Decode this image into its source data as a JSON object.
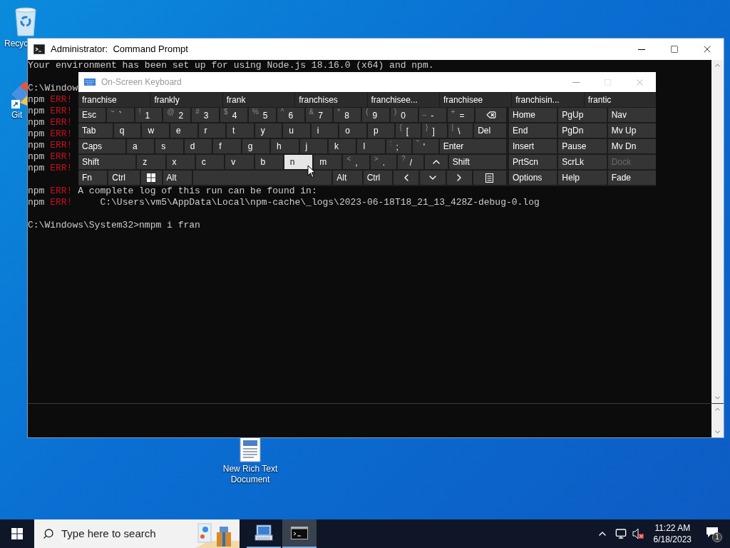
{
  "desktop_icons": [
    {
      "kind": "recycle",
      "label": "Recyc"
    },
    {
      "kind": "git",
      "label": "Git"
    },
    {
      "kind": "document",
      "label": "New Rich Text Document"
    }
  ],
  "console": {
    "title": "Administrator:  Command Prompt",
    "lines": [
      {
        "kind": "text",
        "text": "Your environment has been set up for using Node.js 18.16.0 (x64) and npm."
      },
      {
        "kind": "blank"
      },
      {
        "kind": "text",
        "text": "C:\\Window"
      },
      {
        "kind": "error",
        "prefix": "npm",
        "tag": "ERR!"
      },
      {
        "kind": "error",
        "prefix": "npm",
        "tag": "ERR!"
      },
      {
        "kind": "error",
        "prefix": "npm",
        "tag": "ERR!"
      },
      {
        "kind": "error",
        "prefix": "npm",
        "tag": "ERR!"
      },
      {
        "kind": "error",
        "prefix": "npm",
        "tag": "ERR!"
      },
      {
        "kind": "error",
        "prefix": "npm",
        "tag": "ERR!"
      },
      {
        "kind": "error",
        "prefix": "npm",
        "tag": "ERR!"
      },
      {
        "kind": "blank"
      },
      {
        "kind": "error",
        "prefix": "npm",
        "tag": "ERR!",
        "text": "A complete log of this run can be found in:"
      },
      {
        "kind": "error",
        "prefix": "npm",
        "tag": "ERR!",
        "text": "    C:\\Users\\vm5\\AppData\\Local\\npm-cache\\_logs\\2023-06-18T18_21_13_428Z-debug-0.log"
      },
      {
        "kind": "blank"
      },
      {
        "kind": "text",
        "text": "C:\\Windows\\System32>nmpm i fran"
      }
    ]
  },
  "keyboard": {
    "title": "On-Screen Keyboard",
    "suggestions": [
      "franchise",
      "frankly",
      "frank",
      "franchises",
      "franchisee...",
      "franchisee",
      "franchisin...",
      "frantic"
    ],
    "rows": [
      {
        "keys": [
          {
            "kind": "label",
            "main": "Esc",
            "highlighted": false
          },
          {
            "kind": "char",
            "top": "~",
            "main": "`",
            "highlighted": false
          },
          {
            "kind": "char",
            "top": "!",
            "main": "1",
            "highlighted": false
          },
          {
            "kind": "char",
            "top": "@",
            "main": "2",
            "highlighted": false
          },
          {
            "kind": "char",
            "top": "#",
            "main": "3",
            "highlighted": false
          },
          {
            "kind": "char",
            "top": "$",
            "main": "4",
            "highlighted": false
          },
          {
            "kind": "char",
            "top": "%",
            "main": "5",
            "highlighted": false
          },
          {
            "kind": "char",
            "top": "^",
            "main": "6",
            "highlighted": false
          },
          {
            "kind": "char",
            "top": "&",
            "main": "7",
            "highlighted": false
          },
          {
            "kind": "char",
            "top": "*",
            "main": "8",
            "highlighted": false
          },
          {
            "kind": "char",
            "top": "(",
            "main": "9",
            "highlighted": false
          },
          {
            "kind": "char",
            "top": ")",
            "main": "0",
            "highlighted": false
          },
          {
            "kind": "char",
            "top": "_",
            "main": "-",
            "highlighted": false
          },
          {
            "kind": "char",
            "top": "+",
            "main": "=",
            "highlighted": false
          },
          {
            "kind": "backspace",
            "highlighted": false
          }
        ]
      },
      {
        "keys": [
          {
            "kind": "label",
            "main": "Tab",
            "highlighted": false
          },
          {
            "kind": "letter",
            "main": "q",
            "highlighted": false
          },
          {
            "kind": "letter",
            "main": "w",
            "highlighted": false
          },
          {
            "kind": "letter",
            "main": "e",
            "highlighted": false
          },
          {
            "kind": "letter",
            "main": "r",
            "highlighted": false
          },
          {
            "kind": "letter",
            "main": "t",
            "highlighted": false
          },
          {
            "kind": "letter",
            "main": "y",
            "highlighted": false
          },
          {
            "kind": "letter",
            "main": "u",
            "highlighted": false
          },
          {
            "kind": "letter",
            "main": "i",
            "highlighted": false
          },
          {
            "kind": "letter",
            "main": "o",
            "highlighted": false
          },
          {
            "kind": "letter",
            "main": "p",
            "highlighted": false
          },
          {
            "kind": "char",
            "top": "{",
            "main": "[",
            "highlighted": false
          },
          {
            "kind": "char",
            "top": "}",
            "main": "]",
            "highlighted": false
          },
          {
            "kind": "char",
            "top": "|",
            "main": "\\",
            "highlighted": false
          },
          {
            "kind": "label",
            "main": "Del",
            "highlighted": false
          }
        ]
      },
      {
        "keys": [
          {
            "kind": "label",
            "main": "Caps",
            "highlighted": false
          },
          {
            "kind": "letter",
            "main": "a",
            "highlighted": false
          },
          {
            "kind": "letter",
            "main": "s",
            "highlighted": false
          },
          {
            "kind": "letter",
            "main": "d",
            "highlighted": false
          },
          {
            "kind": "letter",
            "main": "f",
            "highlighted": false
          },
          {
            "kind": "letter",
            "main": "g",
            "highlighted": false
          },
          {
            "kind": "letter",
            "main": "h",
            "highlighted": false
          },
          {
            "kind": "letter",
            "main": "j",
            "highlighted": false
          },
          {
            "kind": "letter",
            "main": "k",
            "highlighted": false
          },
          {
            "kind": "letter",
            "main": "l",
            "highlighted": false
          },
          {
            "kind": "char",
            "top": ":",
            "main": ";",
            "highlighted": false
          },
          {
            "kind": "char",
            "top": "\"",
            "main": "'",
            "highlighted": false
          },
          {
            "kind": "label",
            "main": "Enter",
            "highlighted": false
          }
        ]
      },
      {
        "keys": [
          {
            "kind": "label",
            "main": "Shift",
            "highlighted": false
          },
          {
            "kind": "letter",
            "main": "z",
            "highlighted": false
          },
          {
            "kind": "letter",
            "main": "x",
            "highlighted": false
          },
          {
            "kind": "letter",
            "main": "c",
            "highlighted": false
          },
          {
            "kind": "letter",
            "main": "v",
            "highlighted": false
          },
          {
            "kind": "letter",
            "main": "b",
            "highlighted": false
          },
          {
            "kind": "letter",
            "main": "n",
            "highlighted": true
          },
          {
            "kind": "letter",
            "main": "m",
            "highlighted": false
          },
          {
            "kind": "char",
            "top": "<",
            "main": ",",
            "highlighted": false
          },
          {
            "kind": "char",
            "top": ">",
            "main": ".",
            "highlighted": false
          },
          {
            "kind": "char",
            "top": "?",
            "main": "/",
            "highlighted": false
          },
          {
            "kind": "up",
            "highlighted": false
          },
          {
            "kind": "label",
            "main": "Shift",
            "highlighted": false
          }
        ]
      },
      {
        "keys": [
          {
            "kind": "label",
            "main": "Fn",
            "highlighted": false
          },
          {
            "kind": "label",
            "main": "Ctrl",
            "highlighted": false
          },
          {
            "kind": "windows",
            "highlighted": false
          },
          {
            "kind": "label",
            "main": "Alt",
            "highlighted": false
          },
          {
            "kind": "space",
            "highlighted": false
          },
          {
            "kind": "label",
            "main": "Alt",
            "highlighted": false
          },
          {
            "kind": "label",
            "main": "Ctrl",
            "highlighted": false
          },
          {
            "kind": "left",
            "highlighted": false
          },
          {
            "kind": "down",
            "highlighted": false
          },
          {
            "kind": "right",
            "highlighted": false
          },
          {
            "kind": "menu",
            "highlighted": false
          }
        ]
      }
    ],
    "nav_keys": [
      [
        {
          "label": "Home",
          "disabled": false
        },
        {
          "label": "PgUp",
          "disabled": false
        },
        {
          "label": "Nav",
          "disabled": false
        }
      ],
      [
        {
          "label": "End",
          "disabled": false
        },
        {
          "label": "PgDn",
          "disabled": false
        },
        {
          "label": "Mv Up",
          "disabled": false
        }
      ],
      [
        {
          "label": "Insert",
          "disabled": false
        },
        {
          "label": "Pause",
          "disabled": false
        },
        {
          "label": "Mv Dn",
          "disabled": false
        }
      ],
      [
        {
          "label": "PrtScn",
          "disabled": false
        },
        {
          "label": "ScrLk",
          "disabled": false
        },
        {
          "label": "Dock",
          "disabled": true
        }
      ],
      [
        {
          "label": "Options",
          "disabled": false
        },
        {
          "label": "Help",
          "disabled": false
        },
        {
          "label": "Fade",
          "disabled": false
        }
      ]
    ]
  },
  "taskbar": {
    "search_placeholder": "Type here to search",
    "apps": [
      {
        "kind": "keyboard",
        "active": false
      },
      {
        "kind": "console",
        "active": true
      }
    ],
    "time": "11:22 AM",
    "date": "6/18/2023",
    "notification_count": "1"
  }
}
